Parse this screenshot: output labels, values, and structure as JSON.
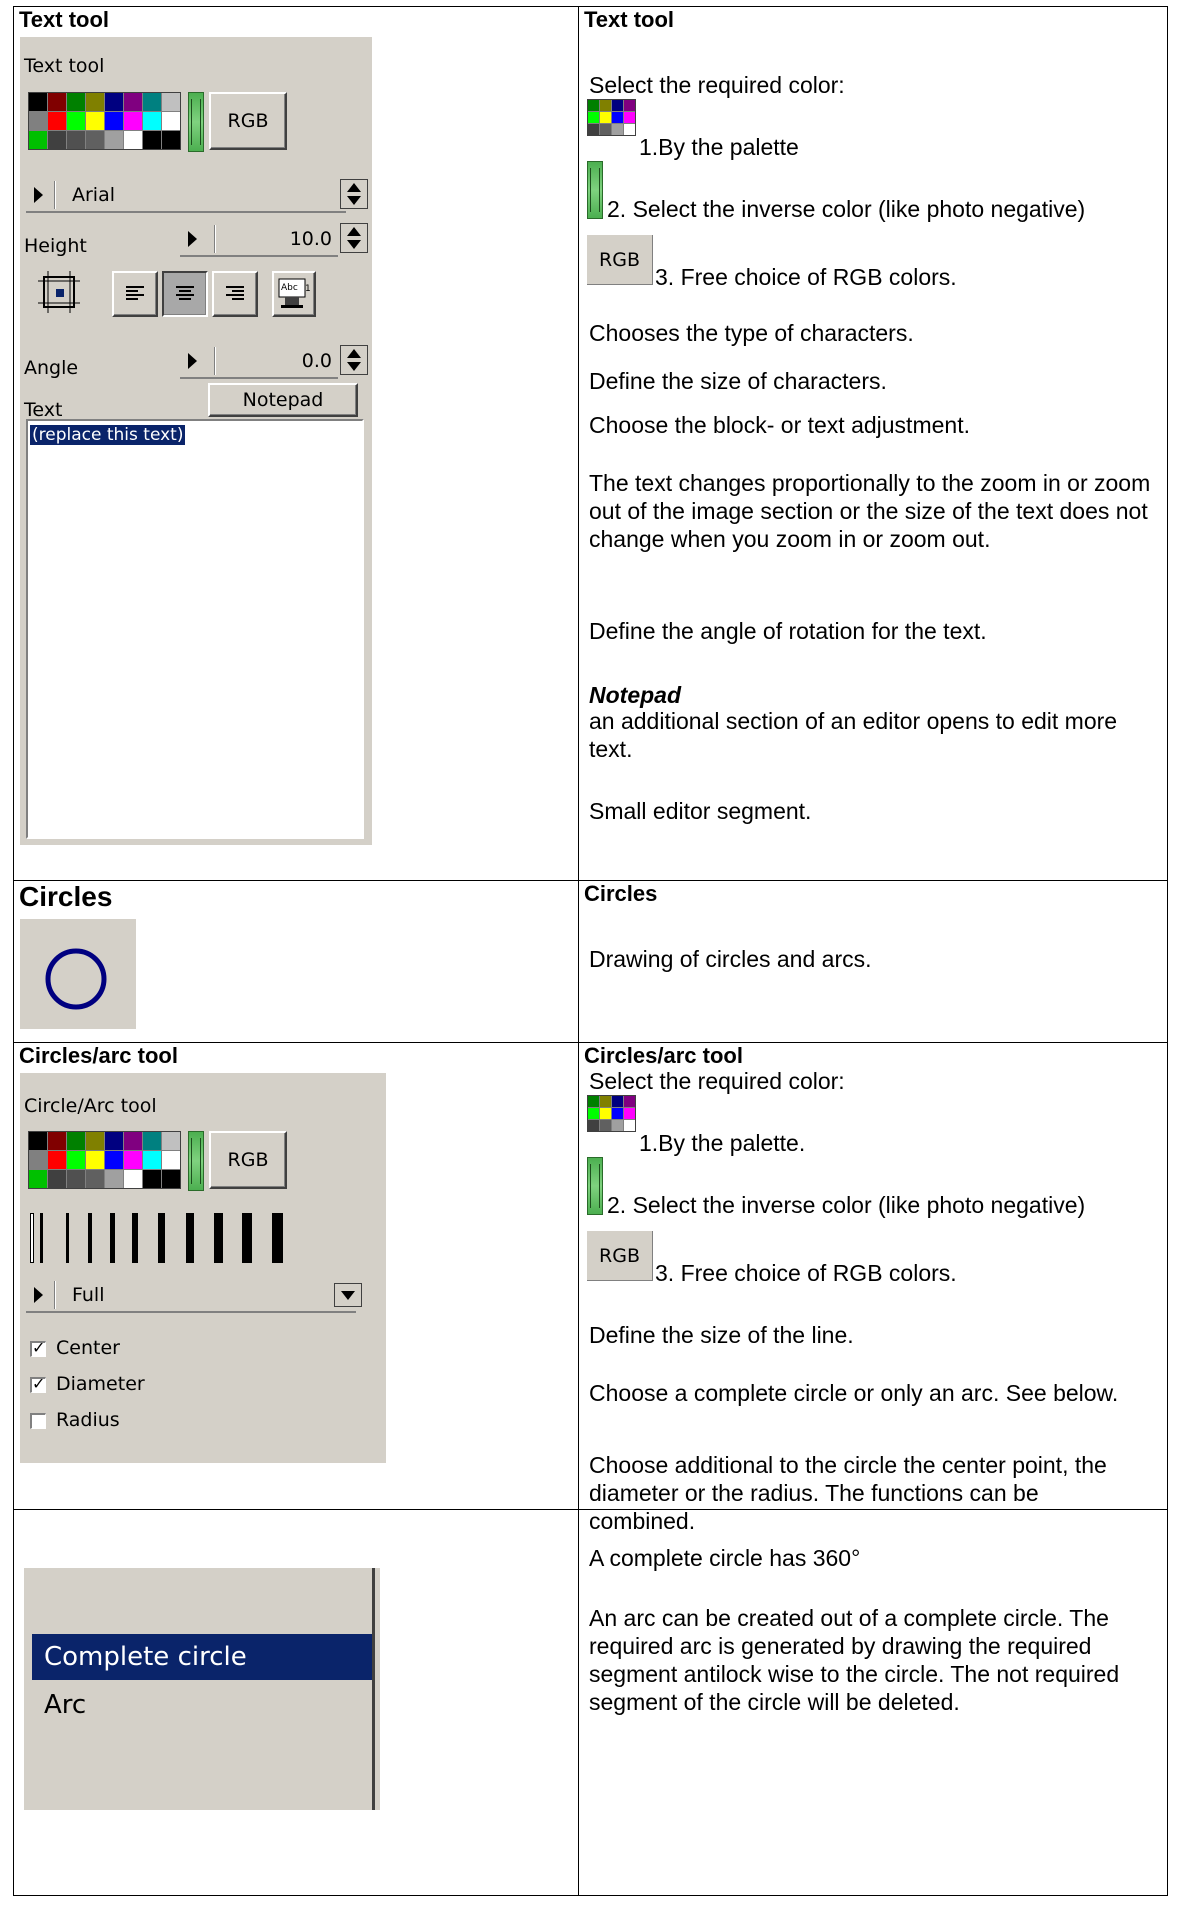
{
  "palette_colors": [
    "#000000",
    "#800000",
    "#008000",
    "#808000",
    "#000080",
    "#800080",
    "#008080",
    "#c0c0c0",
    "#808080",
    "#ff0000",
    "#00ff00",
    "#ffff00",
    "#0000ff",
    "#ff00ff",
    "#00ffff",
    "#ffffff",
    "#00c000",
    "#404040",
    "#505050",
    "#606060",
    "#a0a0a0",
    "#ffffff",
    "#000000",
    "#000000"
  ],
  "mini_palette_colors": [
    "#008000",
    "#808000",
    "#000080",
    "#800080",
    "#00ff00",
    "#ffff00",
    "#0000ff",
    "#ff00ff",
    "#404040",
    "#606060",
    "#a0a0a0",
    "#ffffff"
  ],
  "text_tool": {
    "left_header": "Text tool",
    "right_header": "Text tool",
    "panel": {
      "title": "Text tool",
      "rgb_label": "RGB",
      "font_value": "Arial",
      "height_label": "Height",
      "height_value": "10.0",
      "angle_label": "Angle",
      "angle_value": "0.0",
      "text_label": "Text",
      "notepad_label": "Notepad",
      "textarea_value": "(replace this text)"
    },
    "right": {
      "select_color": "Select the required color:",
      "by_palette": "1.By the palette",
      "inverse": "2. Select the inverse color (like photo negative)",
      "rgb_label": "RGB",
      "free_rgb": "3. Free choice of RGB colors.",
      "chars_type": "Chooses the type of characters.",
      "chars_size": "Define the size of characters.",
      "adjust": "Choose the block- or text adjustment.",
      "zoom": "The text changes proportionally to the zoom in or zoom out of the image section or the size of the text does not change when you zoom in or zoom out.",
      "angle": "Define the angle of rotation for the text.",
      "notepad_title": "Notepad",
      "notepad_desc": "an additional section of an editor opens to edit more text.",
      "small_editor": "Small editor segment."
    }
  },
  "circles": {
    "left_header": "Circles",
    "right_header": "Circles",
    "desc": "Drawing of circles and arcs."
  },
  "circle_tool": {
    "left_header": "Circles/arc tool",
    "right_header": "Circles/arc tool",
    "panel": {
      "title": "Circle/Arc tool",
      "rgb_label": "RGB",
      "mode_value": "Full",
      "center_label": "Center",
      "diameter_label": "Diameter",
      "radius_label": "Radius",
      "center_checked": true,
      "diameter_checked": true,
      "radius_checked": false
    },
    "right": {
      "select_color": "Select the required color:",
      "by_palette": "1.By the palette.",
      "inverse": "2. Select the inverse color (like photo negative)",
      "rgb_label": "RGB",
      "free_rgb": "3. Free choice of RGB colors.",
      "line_size": "Define the size of the line.",
      "complete_or_arc": "Choose a complete circle or only an arc. See below.",
      "additional": "Choose additional to the circle the center point, the diameter or the radius. The functions can be combined."
    }
  },
  "arc_row": {
    "menu_complete": "Complete circle",
    "menu_arc": "Arc",
    "p1": "A complete circle has 360°",
    "p2": "An arc can be created out of a complete circle. The required arc is generated by drawing the required segment antilock wise to the circle. The not required segment of the circle will be deleted."
  }
}
